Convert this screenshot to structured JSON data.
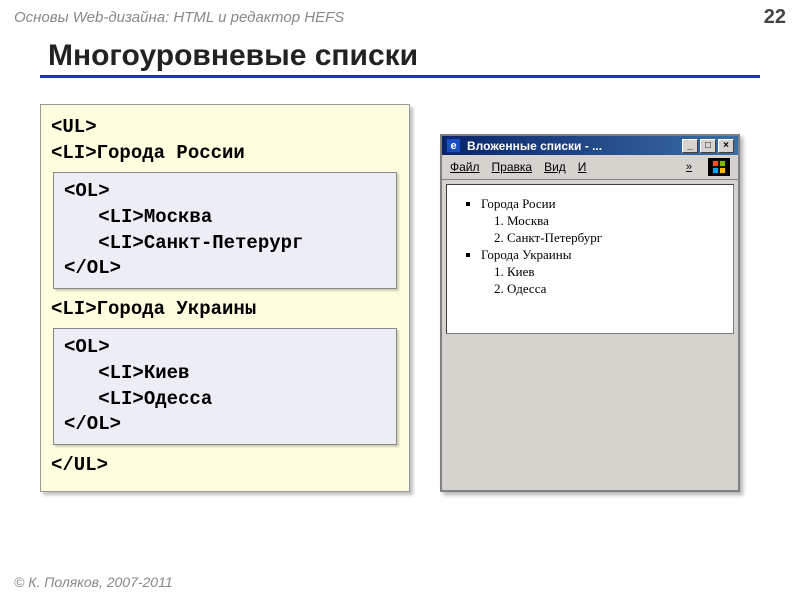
{
  "header": {
    "breadcrumb": "Основы Web-дизайна: HTML и редактор HEFS",
    "page": "22"
  },
  "title": "Многоуровневые списки",
  "code": {
    "ul_open": "<UL>",
    "li_ru": "<LI>Города России",
    "ol1": {
      "open": "<OL>",
      "l1": "   <LI>Москва",
      "l2": "   <LI>Санкт-Петерург",
      "close": "</OL>"
    },
    "li_ua": "<LI>Города Украины",
    "ol2": {
      "open": "<OL>",
      "l1": "   <LI>Киев",
      "l2": "   <LI>Одесса",
      "close": "</OL>"
    },
    "ul_close": "</UL>"
  },
  "browser": {
    "title": "Вложенные списки - ...",
    "menu": {
      "file": "Файл",
      "edit": "Правка",
      "view": "Вид",
      "more": "И",
      "chev": "»"
    },
    "btn": {
      "min": "_",
      "max": "□",
      "close": "×"
    },
    "list": {
      "ru": "Города Росии",
      "ru_items": [
        "Москва",
        "Санкт-Петербург"
      ],
      "ua": "Города Украины",
      "ua_items": [
        "Киев",
        "Одесса"
      ]
    }
  },
  "footer": "© К. Поляков, 2007-2011"
}
